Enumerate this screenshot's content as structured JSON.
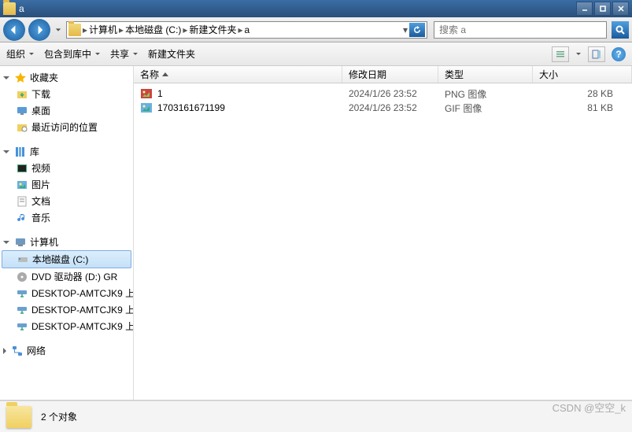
{
  "window": {
    "title": "a"
  },
  "address": {
    "parts": [
      "计算机",
      "本地磁盘 (C:)",
      "新建文件夹",
      "a"
    ]
  },
  "search": {
    "placeholder": "搜索 a"
  },
  "toolbar": {
    "organize": "组织",
    "include": "包含到库中",
    "share": "共享",
    "newfolder": "新建文件夹"
  },
  "sidebar": {
    "favorites": {
      "label": "收藏夹",
      "items": [
        "下载",
        "桌面",
        "最近访问的位置"
      ]
    },
    "libraries": {
      "label": "库",
      "items": [
        "视频",
        "图片",
        "文档",
        "音乐"
      ]
    },
    "computer": {
      "label": "计算机",
      "items": [
        "本地磁盘 (C:)",
        "DVD 驱动器 (D:) GR",
        "DESKTOP-AMTCJK9 上",
        "DESKTOP-AMTCJK9 上",
        "DESKTOP-AMTCJK9 上"
      ],
      "selected": 0
    },
    "network": {
      "label": "网络"
    }
  },
  "columns": {
    "name": "名称",
    "date": "修改日期",
    "type": "类型",
    "size": "大小"
  },
  "files": [
    {
      "name": "1",
      "date": "2024/1/26 23:52",
      "type": "PNG 图像",
      "size": "28 KB",
      "kind": "png"
    },
    {
      "name": "1703161671199",
      "date": "2024/1/26 23:52",
      "type": "GIF 图像",
      "size": "81 KB",
      "kind": "gif"
    }
  ],
  "status": {
    "text": "2 个对象"
  },
  "watermark": "CSDN @空空_k"
}
